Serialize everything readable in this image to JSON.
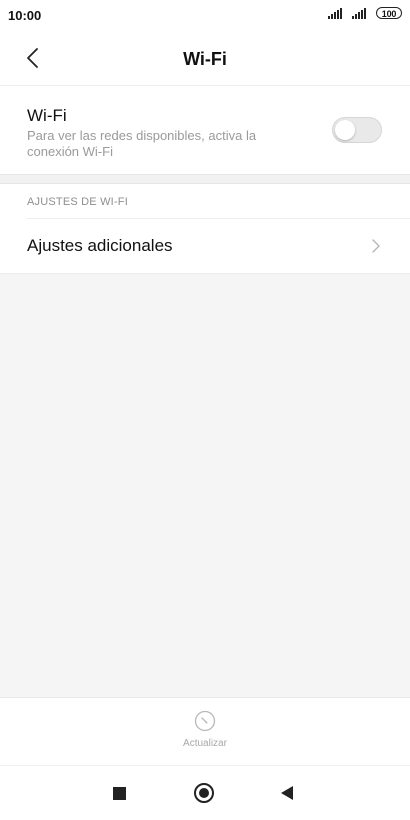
{
  "status_bar": {
    "time": "10:00",
    "battery": "100",
    "icons": [
      "signal-icon",
      "signal-icon",
      "battery-icon"
    ]
  },
  "header": {
    "title": "Wi-Fi",
    "back_icon": "chevron-left-icon"
  },
  "wifi": {
    "title": "Wi-Fi",
    "description": "Para ver las redes disponibles, activa la conexión Wi-Fi",
    "toggle_on": false
  },
  "section": {
    "header": "AJUSTES DE WI-FI",
    "items": [
      {
        "label": "Ajustes adicionales",
        "icon": "chevron-right-icon"
      }
    ]
  },
  "bottom": {
    "refresh_label": "Actualizar",
    "refresh_icon": "refresh-icon"
  },
  "nav": {
    "icons": [
      "square-icon",
      "circle-icon",
      "triangle-back-icon"
    ]
  },
  "colors": {
    "background": "#f5f5f5",
    "surface": "#ffffff",
    "text_primary": "#111111",
    "text_secondary": "#9a9a9a",
    "toggle_off": "#e9e9e9"
  }
}
